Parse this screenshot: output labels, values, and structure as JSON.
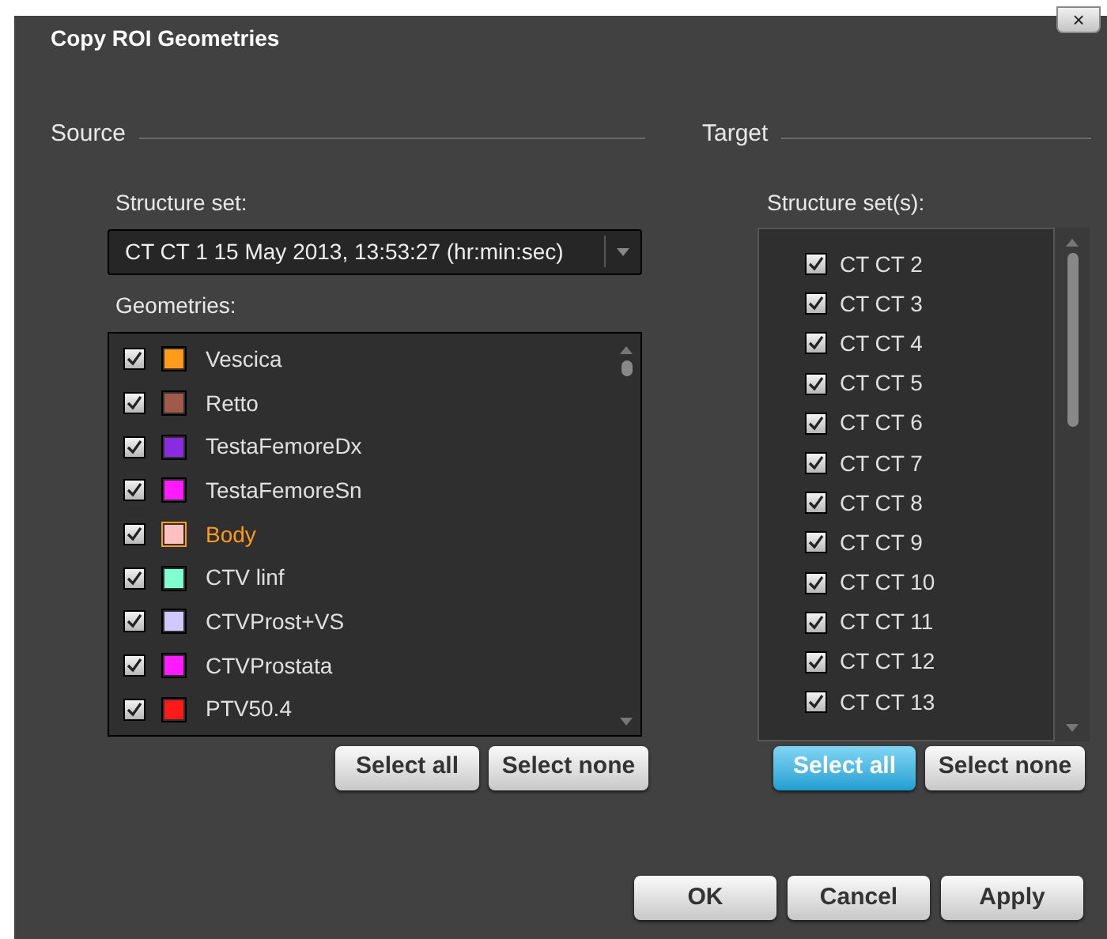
{
  "window": {
    "title": "Copy ROI Geometries",
    "close": "×"
  },
  "source": {
    "heading": "Source",
    "structure_set_label": "Structure set:",
    "structure_set": "CT CT 1 15 May 2013, 13:53:27 (hr:min:sec)",
    "geometries_label": "Geometries:",
    "geometries": [
      {
        "name": "Vescica",
        "checked": true,
        "color": "#ff9a1a",
        "selected": false
      },
      {
        "name": "Retto",
        "checked": true,
        "color": "#a05a4a",
        "selected": false
      },
      {
        "name": "TestaFemoreDx",
        "checked": true,
        "color": "#8a2be2",
        "selected": false
      },
      {
        "name": "TestaFemoreSn",
        "checked": true,
        "color": "#ff1aff",
        "selected": false
      },
      {
        "name": "Body",
        "checked": true,
        "color": "#ffc0c0",
        "selected": true
      },
      {
        "name": "CTV linf",
        "checked": true,
        "color": "#80ffd0",
        "selected": false
      },
      {
        "name": "CTVProst+VS",
        "checked": true,
        "color": "#d0c8ff",
        "selected": false
      },
      {
        "name": "CTVProstata",
        "checked": true,
        "color": "#ff1aff",
        "selected": false
      },
      {
        "name": "PTV50.4",
        "checked": true,
        "color": "#ff1a1a",
        "selected": false
      }
    ],
    "buttons": [
      {
        "label": "Select all",
        "focused": false
      },
      {
        "label": "Select none",
        "focused": false
      }
    ]
  },
  "target": {
    "heading": "Target",
    "structure_sets_label": "Structure set(s):",
    "structure_sets": [
      {
        "name": "CT CT 2",
        "checked": true
      },
      {
        "name": "CT CT 3",
        "checked": true
      },
      {
        "name": "CT CT 4",
        "checked": true
      },
      {
        "name": "CT CT 5",
        "checked": true
      },
      {
        "name": "CT CT 6",
        "checked": true
      },
      {
        "name": "CT CT 7",
        "checked": true
      },
      {
        "name": "CT CT 8",
        "checked": true
      },
      {
        "name": "CT CT 9",
        "checked": true
      },
      {
        "name": "CT CT 10",
        "checked": true
      },
      {
        "name": "CT CT 11",
        "checked": true
      },
      {
        "name": "CT CT 12",
        "checked": true
      },
      {
        "name": "CT CT 13",
        "checked": true
      }
    ],
    "buttons": [
      {
        "label": "Select all",
        "focused": true
      },
      {
        "label": "Select none",
        "focused": false
      }
    ]
  },
  "footer_buttons": [
    "OK",
    "Cancel",
    "Apply"
  ]
}
